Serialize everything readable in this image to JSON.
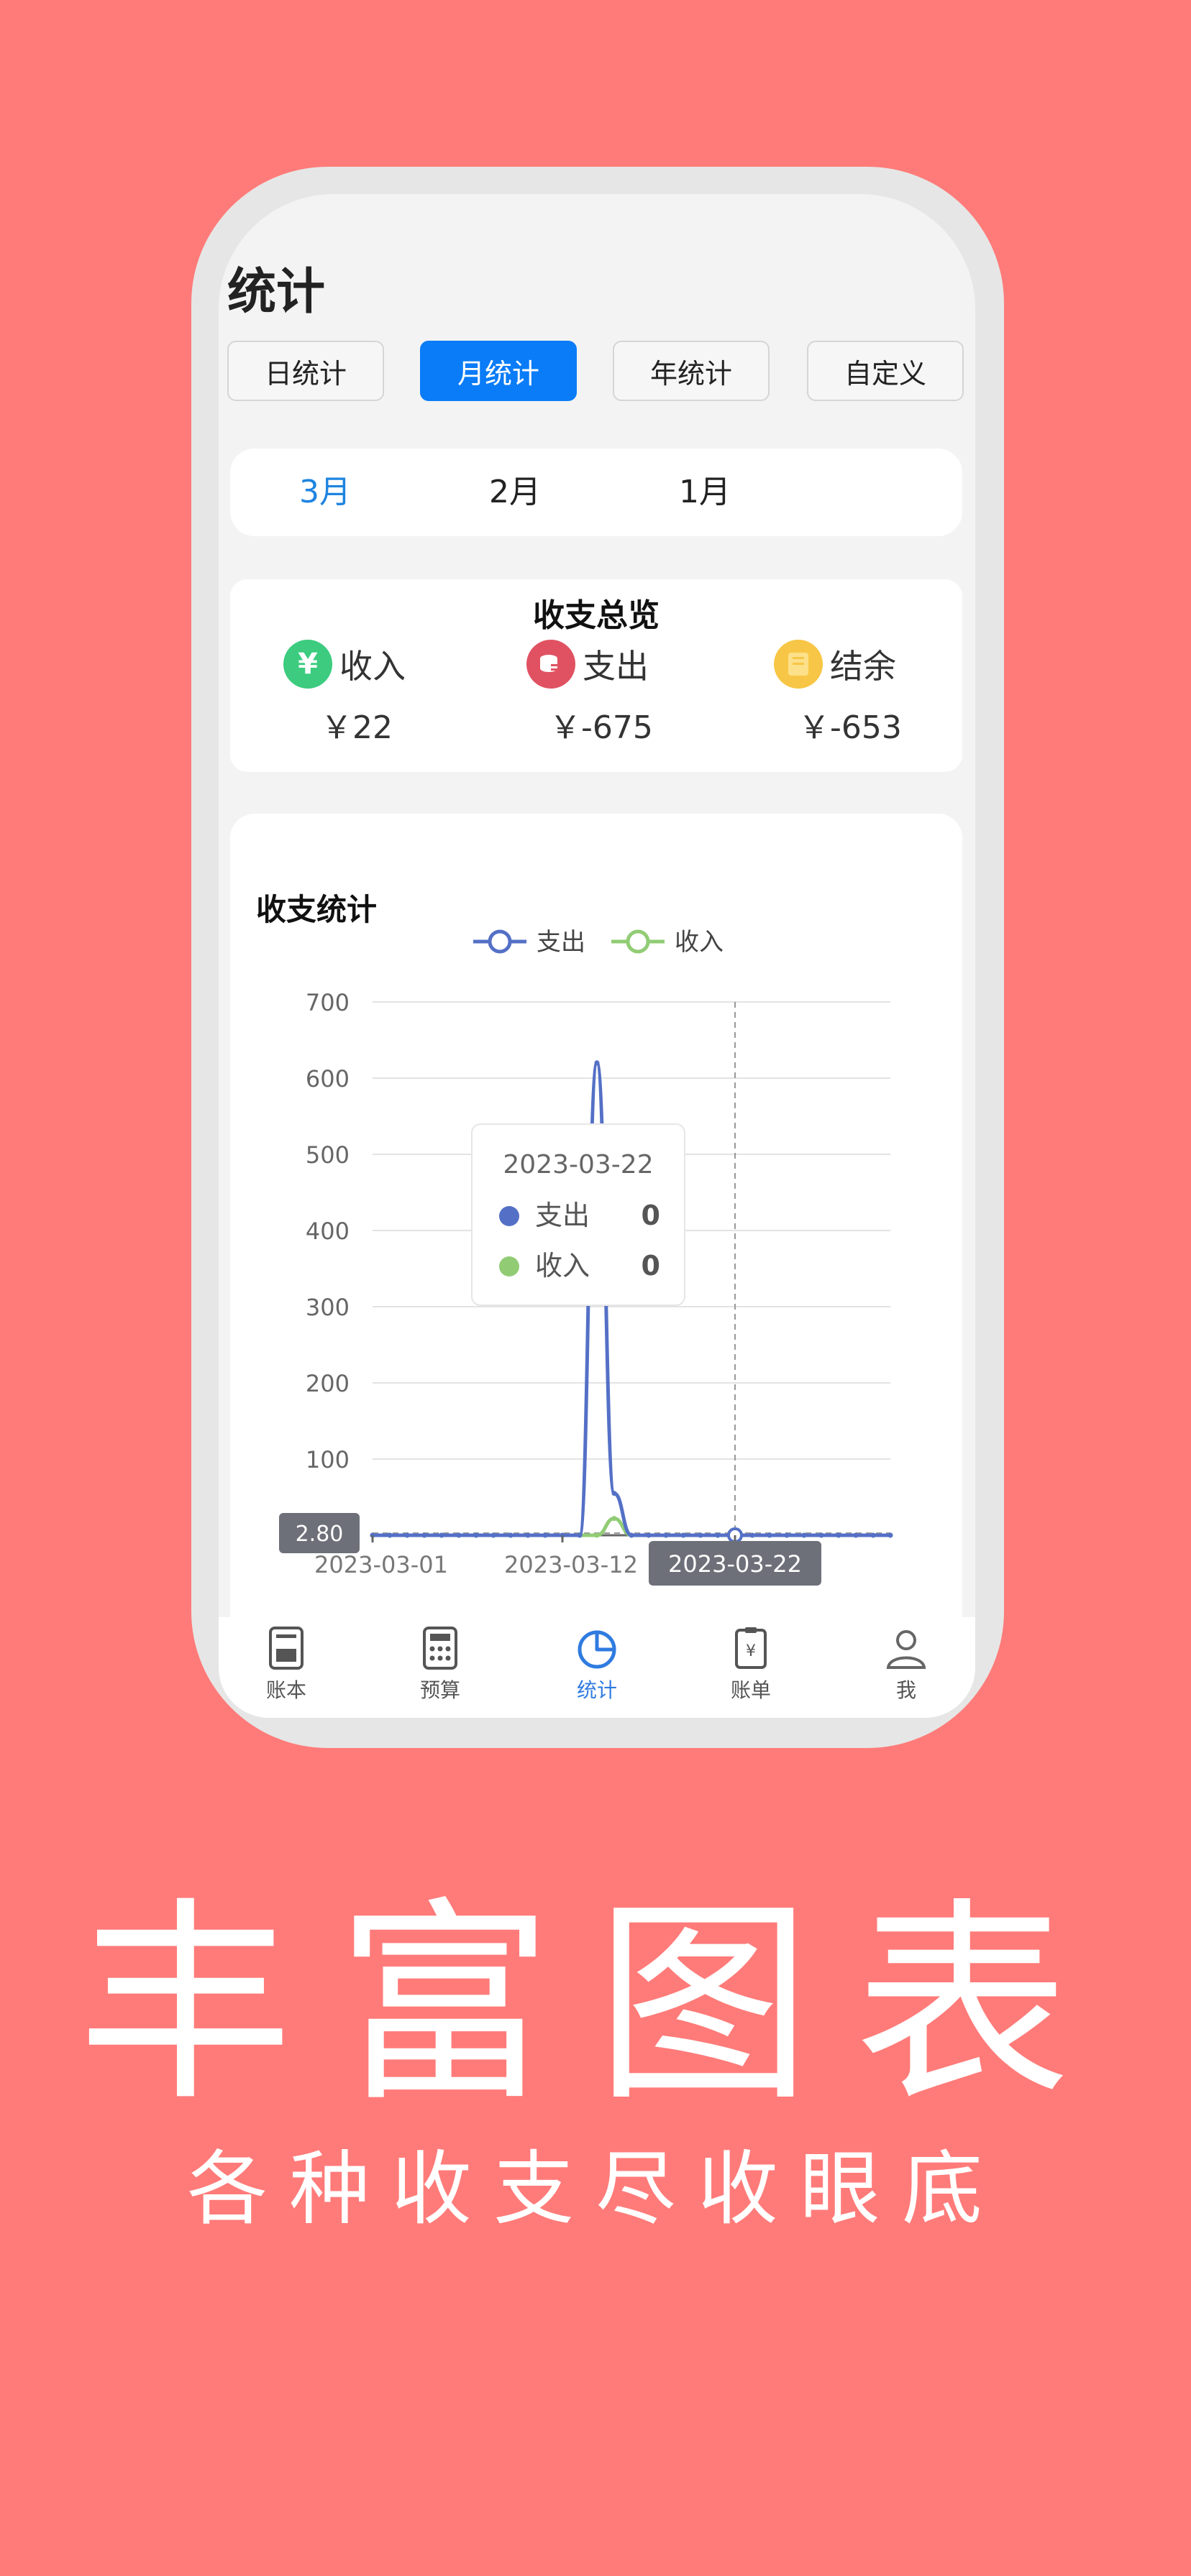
{
  "header": {
    "title": "统计"
  },
  "segments": [
    {
      "label": "日统计",
      "active": false
    },
    {
      "label": "月统计",
      "active": true
    },
    {
      "label": "年统计",
      "active": false
    },
    {
      "label": "自定义",
      "active": false
    }
  ],
  "months": [
    {
      "label": "3月",
      "active": true
    },
    {
      "label": "2月",
      "active": false
    },
    {
      "label": "1月",
      "active": false
    }
  ],
  "overview": {
    "title": "收支总览",
    "income": {
      "label": "收入",
      "value": "￥22",
      "icon": "yen-icon",
      "color": "#3CCB7F"
    },
    "expense": {
      "label": "支出",
      "value": "￥-675",
      "icon": "coins-icon",
      "color": "#E05262"
    },
    "balance": {
      "label": "结余",
      "value": "￥-653",
      "icon": "wallet-icon",
      "color": "#F8C646"
    }
  },
  "chart": {
    "title": "收支统计",
    "tooltip": {
      "date": "2023-03-22",
      "rows": [
        {
          "name": "支出",
          "value": "0",
          "color": "#5470C6"
        },
        {
          "name": "收入",
          "value": "0",
          "color": "#91CC75"
        }
      ]
    },
    "axis_pointer_y_label": "2.80",
    "axis_pointer_x_label": "2023-03-22"
  },
  "chart_data": {
    "type": "line",
    "title": "收支统计",
    "x_tick_labels": [
      "2023-03-01",
      "2023-03-12",
      "2023-03-22"
    ],
    "x": [
      "2023-03-01",
      "2023-03-02",
      "2023-03-03",
      "2023-03-04",
      "2023-03-05",
      "2023-03-06",
      "2023-03-07",
      "2023-03-08",
      "2023-03-09",
      "2023-03-10",
      "2023-03-11",
      "2023-03-12",
      "2023-03-13",
      "2023-03-14",
      "2023-03-15",
      "2023-03-16",
      "2023-03-17",
      "2023-03-18",
      "2023-03-19",
      "2023-03-20",
      "2023-03-21",
      "2023-03-22",
      "2023-03-23",
      "2023-03-24",
      "2023-03-25",
      "2023-03-26",
      "2023-03-27",
      "2023-03-28",
      "2023-03-29",
      "2023-03-30",
      "2023-03-31"
    ],
    "series": [
      {
        "name": "支出",
        "color": "#5470C6",
        "values": [
          0,
          0,
          0,
          0,
          0,
          0,
          0,
          0,
          0,
          0,
          0,
          0,
          0,
          620,
          55,
          0,
          0,
          0,
          0,
          0,
          0,
          0,
          0,
          0,
          0,
          0,
          0,
          0,
          0,
          0,
          0
        ]
      },
      {
        "name": "收入",
        "color": "#91CC75",
        "values": [
          0,
          0,
          0,
          0,
          0,
          0,
          0,
          0,
          0,
          0,
          0,
          0,
          0,
          0,
          22,
          0,
          0,
          0,
          0,
          0,
          0,
          0,
          0,
          0,
          0,
          0,
          0,
          0,
          0,
          0,
          0
        ]
      }
    ],
    "y_ticks": [
      100,
      200,
      300,
      400,
      500,
      600,
      700
    ],
    "ylim": [
      0,
      700
    ],
    "legend_position": "top-center",
    "grid": true
  },
  "tabbar": [
    {
      "label": "账本",
      "icon": "ledger-icon",
      "active": false
    },
    {
      "label": "预算",
      "icon": "calculator-icon",
      "active": false
    },
    {
      "label": "统计",
      "icon": "pie-chart-icon",
      "active": true
    },
    {
      "label": "账单",
      "icon": "bill-icon",
      "active": false
    },
    {
      "label": "我",
      "icon": "user-icon",
      "active": false
    }
  ],
  "promo": {
    "headline": "丰富图表",
    "subline": "各种收支尽收眼底"
  }
}
